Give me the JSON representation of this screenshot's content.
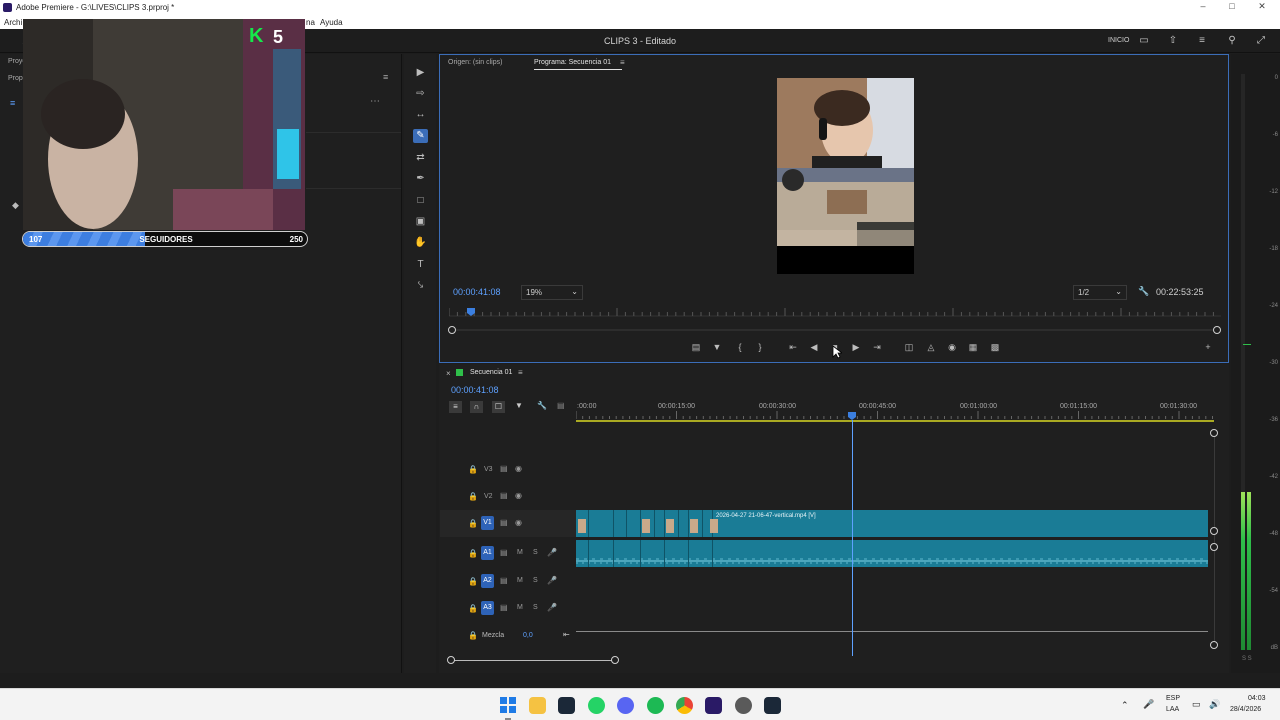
{
  "window": {
    "title": "Adobe Premiere - G:\\LIVES\\CLIPS 3.prproj *",
    "project_title": "CLIPS 3 - Editado",
    "workspace_label": "INICIO",
    "menu_partial_left": "Archi",
    "menu_partial_mid": "na",
    "menu_help": "Ayuda"
  },
  "left_panel": {
    "tab1": "Proye",
    "tab2": "Propi"
  },
  "overlay": {
    "badge_letter": "K",
    "badge_number": "5",
    "progress_label": "SEGUIDORES",
    "progress_current": "107",
    "progress_goal": "250",
    "progress_fraction": 0.428
  },
  "monitor": {
    "tab_source": "Origen: (sin clips)",
    "tab_program": "Programa: Secuencia 01",
    "timecode": "00:00:41:08",
    "zoom": "19%",
    "resolution": "1/2",
    "duration": "00:22:53:25"
  },
  "timeline": {
    "sequence_name": "Secuencia 01",
    "timecode": "00:00:41:08",
    "ruler_labels": [
      ":00:00",
      "00:00:15:00",
      "00:00:30:00",
      "00:00:45:00",
      "00:01:00:00",
      "00:01:15:00",
      "00:01:30:00"
    ],
    "tracks": {
      "v3": "V3",
      "v2": "V2",
      "v1": "V1",
      "a1": "A1",
      "a2": "A2",
      "a3": "A3",
      "mix_label": "Mezcla",
      "mix_value": "0,0"
    },
    "clip_name": "2026-04-27 21-06-47-vertical.mp4 [V]",
    "m_label": "M",
    "s_label": "S"
  },
  "meter": {
    "scale": [
      "0",
      "-6",
      "-12",
      "-18",
      "-24",
      "-30",
      "-36",
      "-42",
      "-48",
      "-54",
      "dB"
    ],
    "bottom": "S S"
  },
  "taskbar": {
    "lang1": "ESP",
    "lang2": "LAA",
    "time": "04:03",
    "date": "28/4/2026"
  },
  "colors": {
    "accent_blue": "#3b6db8",
    "timecode_blue": "#5ea1ff",
    "clip_teal": "#1a7c96",
    "playhead": "#5ea1ff",
    "meter_green": "#2fbf4a"
  }
}
